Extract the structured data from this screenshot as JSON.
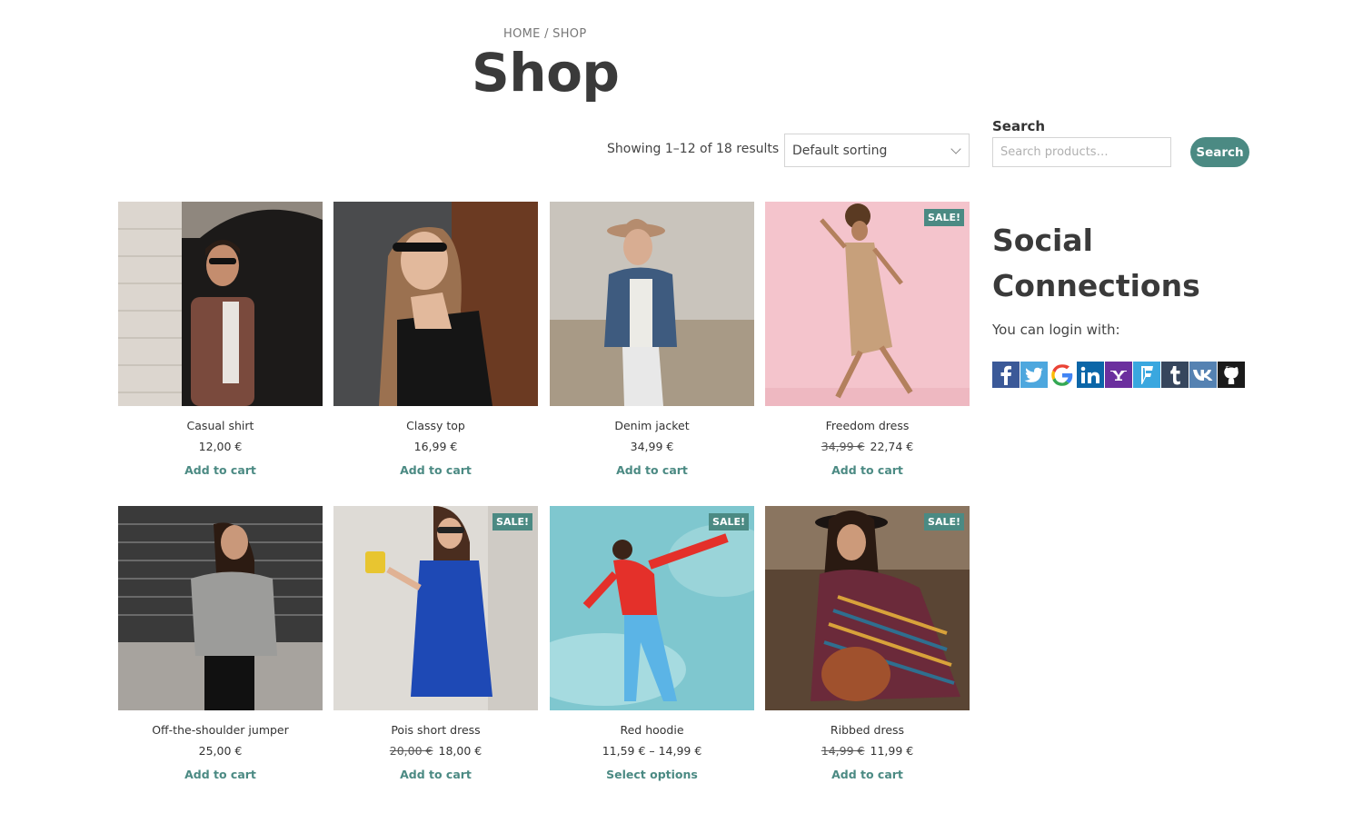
{
  "breadcrumb": "HOME / SHOP",
  "page_title": "Shop",
  "result_count": "Showing 1–12 of 18 results",
  "sorting": {
    "selected": "Default sorting"
  },
  "sidebar": {
    "search_heading": "Search",
    "search_placeholder": "Search products…",
    "search_button": "Search",
    "social_title": "Social Connections",
    "social_subtitle": "You can login with:",
    "providers": [
      {
        "icon": "facebook-icon",
        "color": "#3b5998",
        "glyph": "f"
      },
      {
        "icon": "twitter-icon",
        "color": "#4da7de",
        "glyph": "t"
      },
      {
        "icon": "google-icon",
        "color": "#ffffff",
        "glyph": "G"
      },
      {
        "icon": "linkedin-icon",
        "color": "#0b66a8",
        "glyph": "in"
      },
      {
        "icon": "yahoo-icon",
        "color": "#6b2f9e",
        "glyph": "Y!"
      },
      {
        "icon": "foursquare-icon",
        "color": "#3aa7df",
        "glyph": "F"
      },
      {
        "icon": "tumblr-icon",
        "color": "#36465d",
        "glyph": "t"
      },
      {
        "icon": "vk-icon",
        "color": "#5582b2",
        "glyph": "vk"
      },
      {
        "icon": "github-icon",
        "color": "#1b1b1b",
        "glyph": "gh"
      }
    ]
  },
  "products": [
    {
      "name": "Casual shirt",
      "price": "12,00 €",
      "cta": "Add to cart"
    },
    {
      "name": "Classy top",
      "price": "16,99 €",
      "cta": "Add to cart"
    },
    {
      "name": "Denim jacket",
      "price": "34,99 €",
      "cta": "Add to cart"
    },
    {
      "name": "Freedom dress",
      "old_price": "34,99 €",
      "price": "22,74 €",
      "cta": "Add to cart",
      "sale": "SALE!"
    },
    {
      "name": "Off-the-shoulder jumper",
      "price": "25,00 €",
      "cta": "Add to cart"
    },
    {
      "name": "Pois short dress",
      "old_price": "20,00 €",
      "price": "18,00 €",
      "cta": "Add to cart",
      "sale": "SALE!"
    },
    {
      "name": "Red hoodie",
      "price": "11,59 € – 14,99 €",
      "cta": "Select options",
      "sale": "SALE!"
    },
    {
      "name": "Ribbed dress",
      "old_price": "14,99 €",
      "price": "11,99 €",
      "cta": "Add to cart",
      "sale": "SALE!"
    }
  ],
  "colors": {
    "accent": "#4b8a83"
  }
}
